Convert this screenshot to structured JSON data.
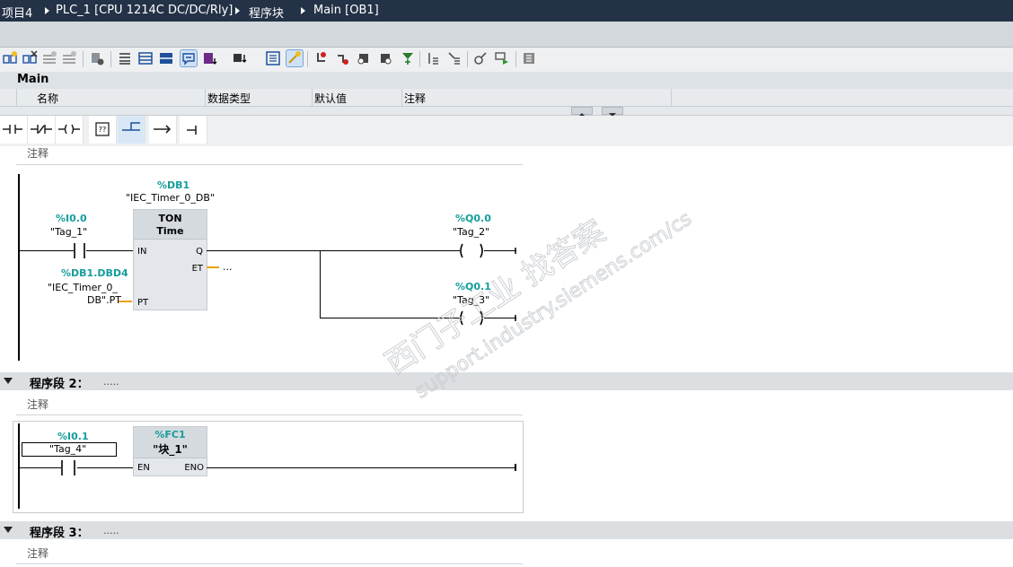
{
  "breadcrumb": {
    "items": [
      "项目4",
      "PLC_1 [CPU 1214C DC/DC/Rly]",
      "程序块",
      "Main [OB1]"
    ]
  },
  "interface": {
    "block_name": "Main",
    "columns": [
      "名称",
      "数据类型",
      "默认值",
      "注释"
    ]
  },
  "network1": {
    "comment_label": "注释",
    "timer_instance": {
      "address": "%DB1",
      "name": "\"IEC_Timer_0_DB\""
    },
    "timer": {
      "type": "TON",
      "subtype": "Time",
      "pin_in": "IN",
      "pin_pt": "PT",
      "pin_q": "Q",
      "pin_et": "ET",
      "et_value": "..."
    },
    "contact": {
      "address": "%I0.0",
      "tag": "\"Tag_1\""
    },
    "pt_param": {
      "address": "%DB1.DBD4",
      "tag_line1": "\"IEC_Timer_0_",
      "tag_line2": "DB\".PT"
    },
    "coil1": {
      "address": "%Q0.0",
      "tag": "\"Tag_2\""
    },
    "coil2": {
      "address": "%Q0.1",
      "tag": "\"Tag_3\""
    }
  },
  "network2": {
    "title": "程序段 2：",
    "dots": ".....",
    "comment_label": "注释",
    "contact": {
      "address": "%I0.1",
      "tag": "\"Tag_4\""
    },
    "fc": {
      "address": "%FC1",
      "name": "\"块_1\"",
      "pin_en": "EN",
      "pin_eno": "ENO"
    }
  },
  "network3": {
    "title": "程序段 3：",
    "dots": ".....",
    "comment_label": "注释"
  },
  "watermark": {
    "line1": "西门子工业  找答案",
    "line2": "support.industry.siemens.com/cs"
  }
}
